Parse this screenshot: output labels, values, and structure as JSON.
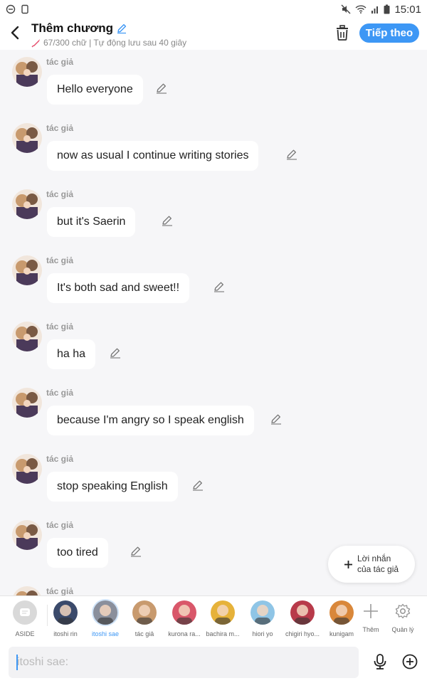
{
  "status_bar": {
    "time": "15:01"
  },
  "header": {
    "title": "Thêm chương",
    "subtitle": "67/300 chữ | Tự động lưu sau 40 giây",
    "next_label": "Tiếp theo"
  },
  "messages": [
    {
      "author": "tác giả",
      "text": "Hello everyone"
    },
    {
      "author": "tác giả",
      "text": "now as usual I continue writing stories"
    },
    {
      "author": "tác giả",
      "text": "but it's Saerin"
    },
    {
      "author": "tác giả",
      "text": "It's both sad and sweet!!"
    },
    {
      "author": "tác giả",
      "text": "ha ha"
    },
    {
      "author": "tác giả",
      "text": "because I'm angry so I speak english"
    },
    {
      "author": "tác giả",
      "text": "stop speaking English"
    },
    {
      "author": "tác giả",
      "text": "too tired"
    },
    {
      "author": "tác giả",
      "text": ""
    }
  ],
  "author_note": {
    "line1": "Lời nhắn",
    "line2": "của tác giả"
  },
  "characters": [
    {
      "name": "ASIDE",
      "color": "#d9d9d9"
    },
    {
      "name": "itoshi rin",
      "color": "#3b4a6b"
    },
    {
      "name": "itoshi sae",
      "color": "#8a8f9c",
      "active": true
    },
    {
      "name": "tác giả",
      "color": "#c89a6e"
    },
    {
      "name": "kurona ra...",
      "color": "#d9576a"
    },
    {
      "name": "bachira m...",
      "color": "#e6b23a"
    },
    {
      "name": "hiori yo",
      "color": "#8fc5e6"
    },
    {
      "name": "chigiri hyo...",
      "color": "#b83a4a"
    },
    {
      "name": "kunigam",
      "color": "#d9873a"
    }
  ],
  "more_label": "Thêm",
  "manage_label": "Quản lý",
  "input": {
    "placeholder": "itoshi sae:"
  },
  "colors": {
    "accent": "#3d97f5"
  }
}
